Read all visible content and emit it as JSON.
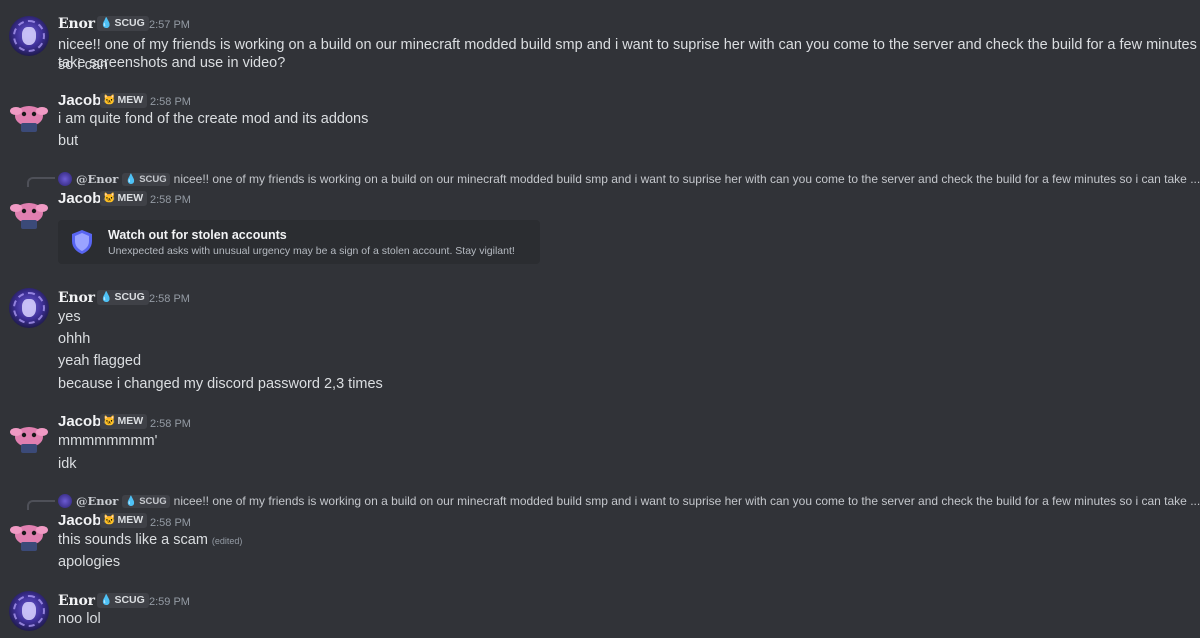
{
  "users": {
    "enor": {
      "name": "Enor",
      "tag": "SCUG"
    },
    "jacob": {
      "name": "Jacob",
      "tag": "MEW"
    }
  },
  "messages": [
    {
      "author": "Enor",
      "time": "2:57 PM",
      "lines": [
        "nicee!! one of my friends is working on a build on our minecraft modded build smp and i want to suprise her with can you come to the server and check the build for a few minutes so i can",
        "take screenshots and use in video?"
      ]
    },
    {
      "author": "Jacob",
      "time": "2:58 PM",
      "lines": [
        "i am quite fond of the create mod and its addons",
        "but"
      ]
    },
    {
      "author": "Jacob",
      "time": "2:58 PM",
      "reply": {
        "mention": "@Enor",
        "tag": "SCUG",
        "text": "nicee!! one of my friends is working on a build on our minecraft modded build smp and i want to suprise her with can you come to the server and check the build for a few minutes so i can take ..."
      },
      "warning": {
        "title": "Watch out for stolen accounts",
        "subtitle": "Unexpected asks with unusual urgency may be a sign of a stolen account. Stay vigilant!"
      }
    },
    {
      "author": "Enor",
      "time": "2:58 PM",
      "lines": [
        "yes",
        "ohhh",
        "yeah flagged",
        "because i changed my discord password 2,3 times"
      ]
    },
    {
      "author": "Jacob",
      "time": "2:58 PM",
      "lines": [
        "mmmmmmmm'",
        "idk"
      ]
    },
    {
      "author": "Jacob",
      "time": "2:58 PM",
      "reply": {
        "mention": "@Enor",
        "tag": "SCUG",
        "text": "nicee!! one of my friends is working on a build on our minecraft modded build smp and i want to suprise her with can you come to the server and check the build for a few minutes so i can take ..."
      },
      "lines": [
        "this sounds like a scam",
        "apologies"
      ],
      "edited": "(edited)"
    },
    {
      "author": "Enor",
      "time": "2:59 PM",
      "lines": [
        "noo lol"
      ]
    }
  ],
  "icons": {
    "enor_tag": "droplet-icon",
    "jacob_tag": "cat-face-icon",
    "warning": "shield-icon"
  },
  "colors": {
    "background": "#313338",
    "embed": "#2b2d31",
    "text": "#dbdee1",
    "muted": "#949ba4"
  }
}
